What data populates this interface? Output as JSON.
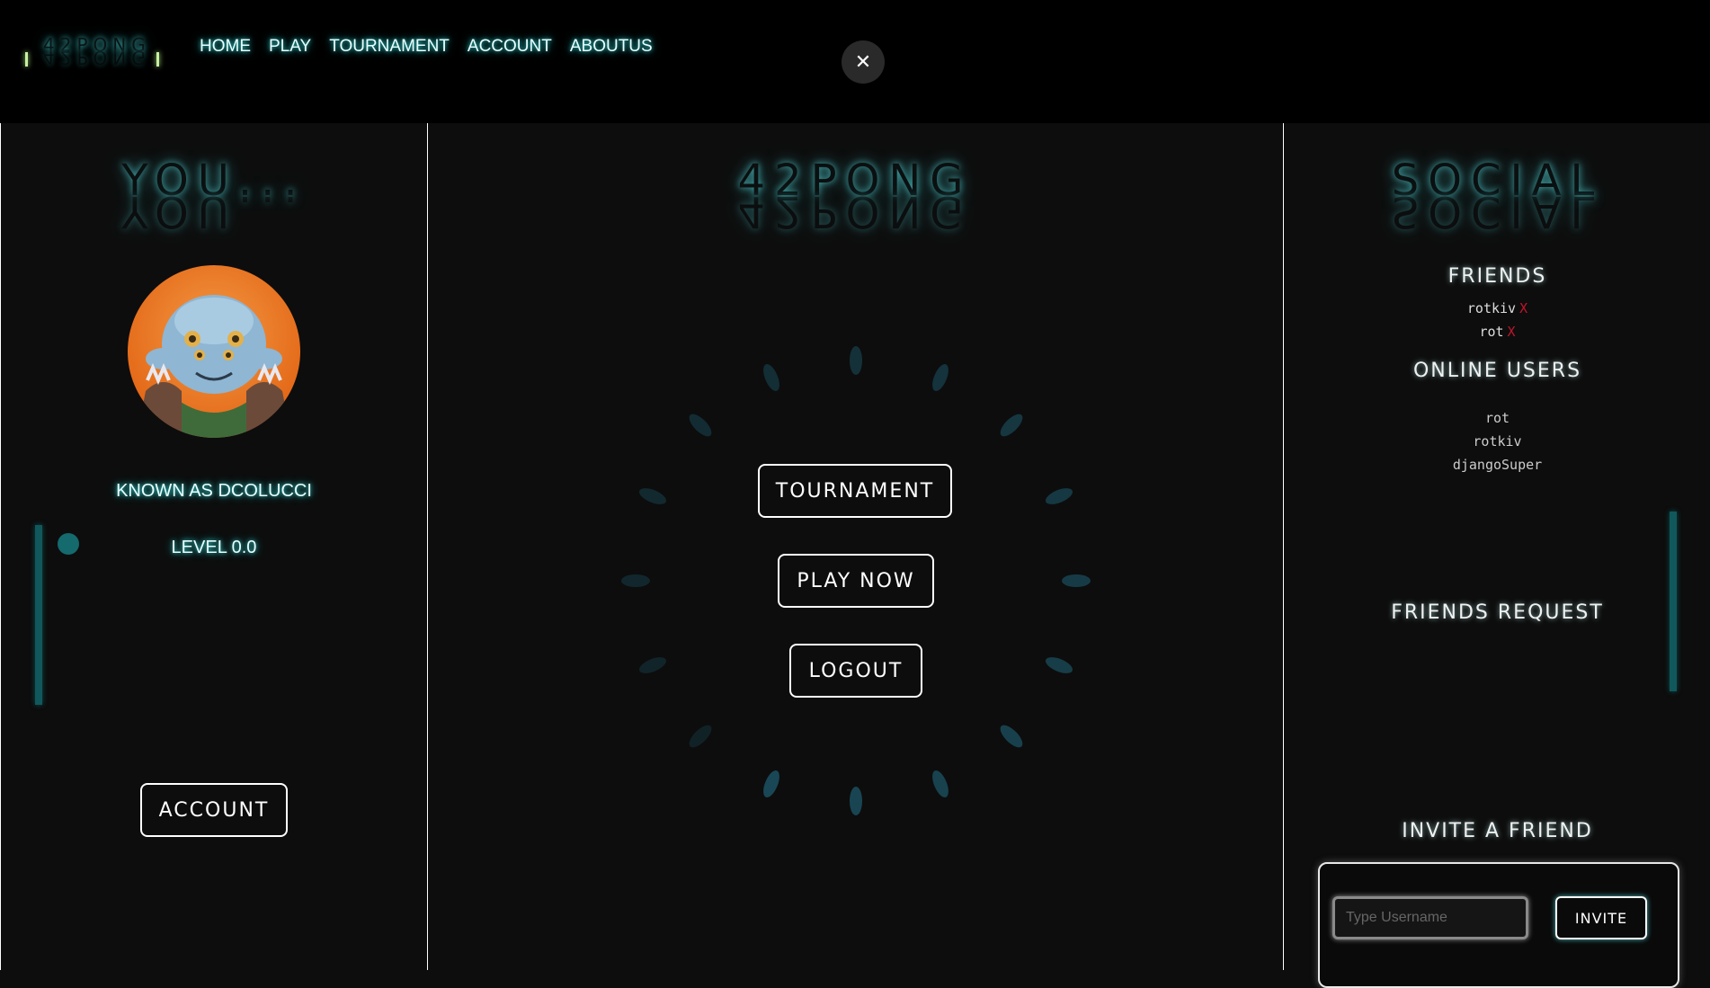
{
  "logo": {
    "text": "42PONG"
  },
  "nav": {
    "items": [
      "HOME",
      "PLAY",
      "TOURNAMENT",
      "ACCOUNT",
      "ABOUTUS"
    ]
  },
  "close_symbol": "✕",
  "left": {
    "heading": "YOU...",
    "known_as": "KNOWN AS DCOLUCCI",
    "level": "LEVEL 0.0",
    "account_button": "ACCOUNT"
  },
  "center": {
    "heading": "42PONG",
    "buttons": {
      "tournament": "TOURNAMENT",
      "play_now": "PLAY NOW",
      "logout": "LOGOUT"
    }
  },
  "right": {
    "heading": "SOCIAL",
    "friends_title": "FRIENDS",
    "friends": [
      {
        "name": "rotkiv",
        "remove": "X"
      },
      {
        "name": "rot",
        "remove": "X"
      }
    ],
    "online_title": "ONLINE USERS",
    "online_users": [
      "rot",
      "rotkiv",
      "djangoSuper"
    ],
    "requests_title": "FRIENDS REQUEST",
    "invite_title": "INVITE A FRIEND",
    "invite_placeholder": "Type Username",
    "invite_button": "INVITE"
  },
  "colors": {
    "accent_glow": "#37c8c8",
    "remove_x": "#c0152a"
  }
}
